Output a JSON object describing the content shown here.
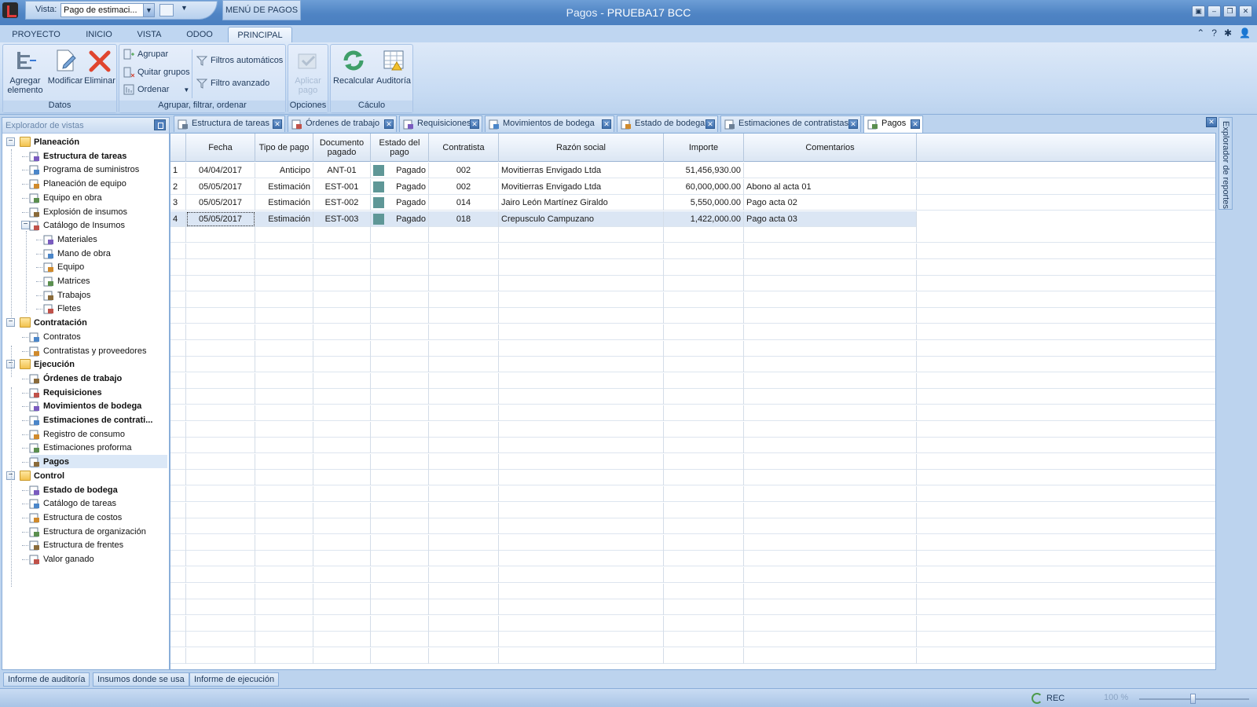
{
  "titlebar": {
    "vista_label": "Vista:",
    "vista_value": "Pago de estimaci...",
    "menu_pagos": "MENÚ DE PAGOS",
    "title_prefix": "Pagos - ",
    "title_project": "PRUEBA17 BCC"
  },
  "ribbon_tabs": [
    "PROYECTO",
    "INICIO",
    "VISTA",
    "ODOO",
    "PRINCIPAL"
  ],
  "ribbon": {
    "datos": {
      "label": "Datos",
      "agregar": "Agregar elemento",
      "agregar_l1": "Agregar",
      "agregar_l2": "elemento",
      "modificar": "Modificar",
      "eliminar": "Eliminar"
    },
    "agrupar": {
      "label": "Agrupar, filtrar, ordenar",
      "agrupar": "Agrupar",
      "quitar": "Quitar grupos",
      "ordenar": "Ordenar",
      "filtros_auto": "Filtros automáticos",
      "filtro_avanzado": "Filtro avanzado"
    },
    "opciones": {
      "label": "Opciones",
      "aplicar_l1": "Aplicar",
      "aplicar_l2": "pago"
    },
    "calculo": {
      "label": "Cáculo",
      "recalcular": "Recalcular",
      "auditoria": "Auditoría"
    }
  },
  "explorer": {
    "title": "Explorador de vistas",
    "items": [
      {
        "label": "Planeación",
        "level": 0,
        "style": "group"
      },
      {
        "label": "Estructura de tareas",
        "level": 1,
        "style": "bold"
      },
      {
        "label": "Programa de suministros",
        "level": 1,
        "style": "normal"
      },
      {
        "label": "Planeación de equipo",
        "level": 1,
        "style": "normal"
      },
      {
        "label": "Equipo en obra",
        "level": 1,
        "style": "normal"
      },
      {
        "label": "Explosión de insumos",
        "level": 1,
        "style": "normal"
      },
      {
        "label": "Catálogo de Insumos",
        "level": 1,
        "style": "normal"
      },
      {
        "label": "Materiales",
        "level": 2,
        "style": "normal"
      },
      {
        "label": "Mano de obra",
        "level": 2,
        "style": "normal"
      },
      {
        "label": "Equipo",
        "level": 2,
        "style": "normal"
      },
      {
        "label": "Matrices",
        "level": 2,
        "style": "normal"
      },
      {
        "label": "Trabajos",
        "level": 2,
        "style": "normal"
      },
      {
        "label": "Fletes",
        "level": 2,
        "style": "normal"
      },
      {
        "label": "Contratación",
        "level": 0,
        "style": "group"
      },
      {
        "label": "Contratos",
        "level": 1,
        "style": "normal"
      },
      {
        "label": "Contratistas y proveedores",
        "level": 1,
        "style": "normal"
      },
      {
        "label": "Ejecución",
        "level": 0,
        "style": "group"
      },
      {
        "label": "Órdenes de trabajo",
        "level": 1,
        "style": "bold"
      },
      {
        "label": "Requisiciones",
        "level": 1,
        "style": "bold"
      },
      {
        "label": "Movimientos de bodega",
        "level": 1,
        "style": "bold"
      },
      {
        "label": "Estimaciones de contrati...",
        "level": 1,
        "style": "bold"
      },
      {
        "label": "Registro de consumo",
        "level": 1,
        "style": "normal"
      },
      {
        "label": "Estimaciones proforma",
        "level": 1,
        "style": "normal"
      },
      {
        "label": "Pagos",
        "level": 1,
        "style": "bold",
        "selected": true
      },
      {
        "label": "Control",
        "level": 0,
        "style": "group"
      },
      {
        "label": "Estado de bodega",
        "level": 1,
        "style": "bold"
      },
      {
        "label": "Catálogo de tareas",
        "level": 1,
        "style": "normal"
      },
      {
        "label": "Estructura de costos",
        "level": 1,
        "style": "normal"
      },
      {
        "label": "Estructura de organización",
        "level": 1,
        "style": "normal"
      },
      {
        "label": "Estructura de frentes",
        "level": 1,
        "style": "normal"
      },
      {
        "label": "Valor ganado",
        "level": 1,
        "style": "normal"
      }
    ]
  },
  "doc_tabs": [
    "Estructura de tareas",
    "Órdenes de trabajo",
    "Requisiciones",
    "Movimientos de bodega",
    "Estado de bodega",
    "Estimaciones de contratistas",
    "Pagos"
  ],
  "grid": {
    "headers": [
      "Fecha",
      "Tipo de pago",
      "Documento pagado",
      "Estado del pago",
      "Contratista",
      "Razón social",
      "Importe",
      "Comentarios"
    ],
    "rows": [
      {
        "n": "1",
        "fecha": "04/04/2017",
        "tipo": "Anticipo",
        "doc": "ANT-01",
        "estado": "Pagado",
        "contratista": "002",
        "razon": "Movitierras Envigado Ltda",
        "importe": "51,456,930.00",
        "comentarios": ""
      },
      {
        "n": "2",
        "fecha": "05/05/2017",
        "tipo": "Estimación",
        "doc": "EST-001",
        "estado": "Pagado",
        "contratista": "002",
        "razon": "Movitierras Envigado Ltda",
        "importe": "60,000,000.00",
        "comentarios": "Abono al acta 01"
      },
      {
        "n": "3",
        "fecha": "05/05/2017",
        "tipo": "Estimación",
        "doc": "EST-002",
        "estado": "Pagado",
        "contratista": "014",
        "razon": "Jairo León Martínez Giraldo",
        "importe": "5,550,000.00",
        "comentarios": "Pago acta 02"
      },
      {
        "n": "4",
        "fecha": "05/05/2017",
        "tipo": "Estimación",
        "doc": "EST-003",
        "estado": "Pagado",
        "contratista": "018",
        "razon": "Crepusculo Campuzano",
        "importe": "1,422,000.00",
        "comentarios": "Pago acta 03"
      }
    ]
  },
  "side_panel": "Explorador de reportes",
  "bottom_tabs": [
    "Informe de auditoría",
    "Insumos donde se usa",
    "Informe de ejecución"
  ],
  "status": {
    "rec": "REC",
    "zoom": "100 %"
  },
  "colors": {
    "status_paid": "#5f9797",
    "accent": "#4f84c4"
  }
}
